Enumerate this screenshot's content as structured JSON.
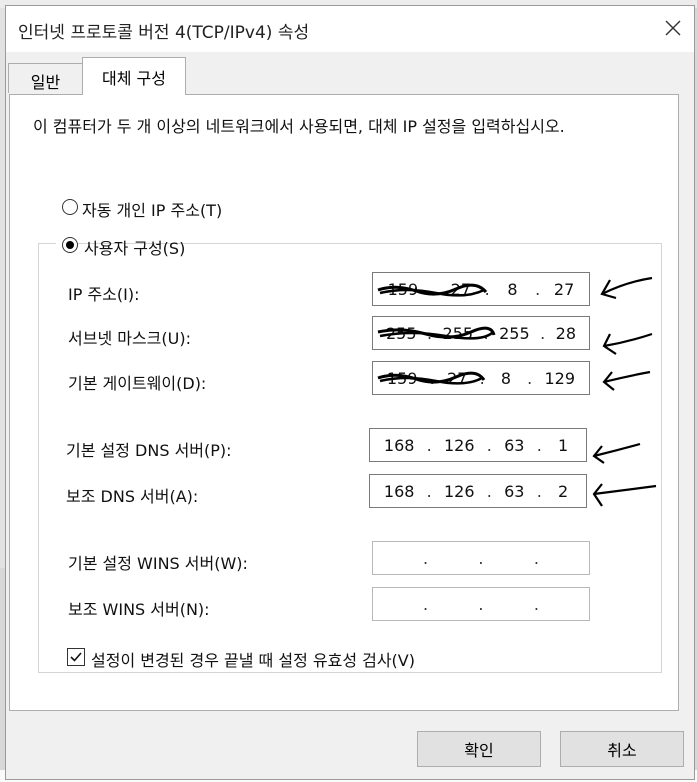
{
  "window": {
    "title": "인터넷 프로토콜 버전 4(TCP/IPv4) 속성"
  },
  "icons": {
    "close": "close-icon",
    "check": "check-icon",
    "arrow": "arrow-annotation-icon"
  },
  "tabs": [
    {
      "label": "일반",
      "selected": false
    },
    {
      "label": "대체 구성",
      "selected": true
    }
  ],
  "description": "이 컴퓨터가 두 개 이상의 네트워크에서 사용되면, 대체 IP 설정을 입력하십시오.",
  "radio_auto": {
    "label": "자동 개인 IP 주소(T)",
    "checked": false
  },
  "radio_user": {
    "label": "사용자 구성(S)",
    "checked": true
  },
  "fields": {
    "ip": {
      "label": "IP 주소(I):",
      "octets": [
        "159",
        "27",
        "8",
        "27"
      ]
    },
    "subnet": {
      "label": "서브넷 마스크(U):",
      "octets": [
        "255",
        "255",
        "255",
        "28"
      ]
    },
    "gateway": {
      "label": "기본 게이트웨이(D):",
      "octets": [
        "159",
        "27",
        "8",
        "129"
      ]
    },
    "dns1": {
      "label": "기본 설정 DNS 서버(P):",
      "octets": [
        "168",
        "126",
        "63",
        "1"
      ]
    },
    "dns2": {
      "label": "보조 DNS 서버(A):",
      "octets": [
        "168",
        "126",
        "63",
        "2"
      ]
    },
    "wins1": {
      "label": "기본 설정 WINS 서버(W):",
      "octets": [
        "",
        "",
        "",
        ""
      ]
    },
    "wins2": {
      "label": "보조 WINS 서버(N):",
      "octets": [
        "",
        "",
        "",
        ""
      ]
    }
  },
  "validate": {
    "label": "설정이 변경된 경우 끝낼 때 설정 유효성 검사(V)",
    "checked": true
  },
  "buttons": {
    "ok": "확인",
    "cancel": "취소"
  }
}
